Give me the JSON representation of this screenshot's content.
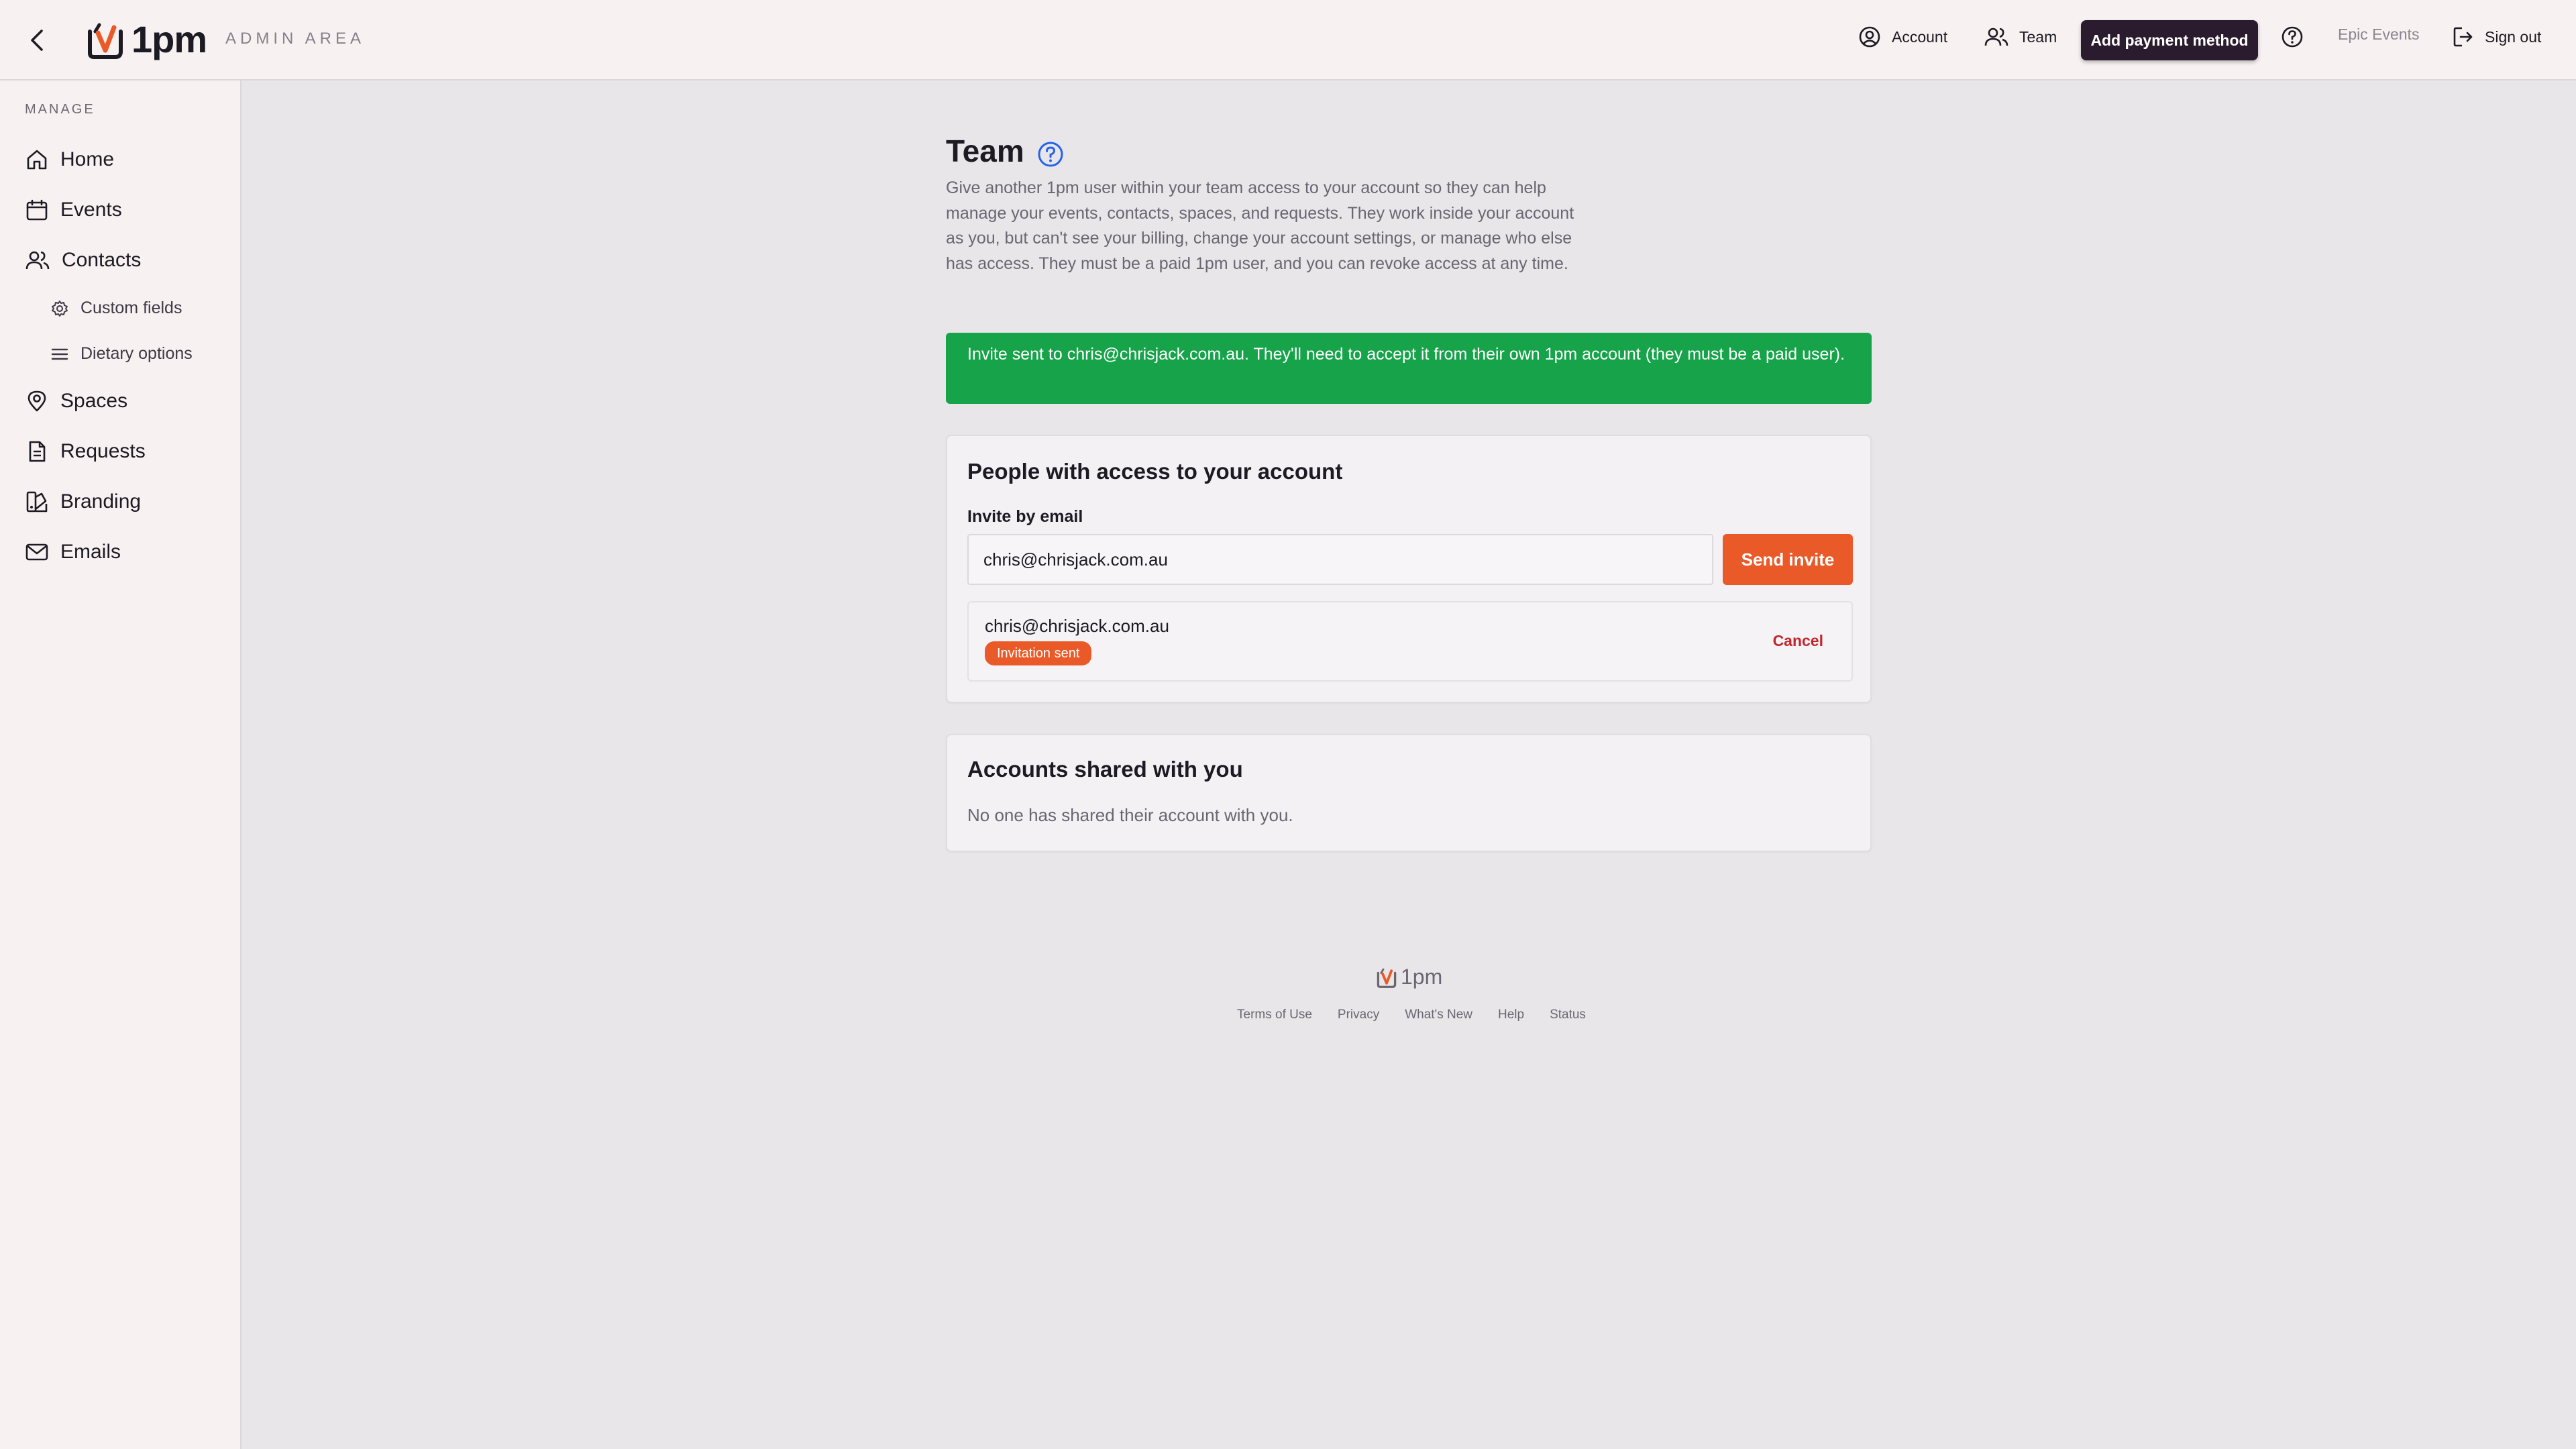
{
  "header": {
    "logo_text": "1pm",
    "area_label": "ADMIN AREA",
    "nav": {
      "account": "Account",
      "team": "Team",
      "add_payment": "Add payment method",
      "org": "Epic Events",
      "sign_out": "Sign out"
    }
  },
  "sidebar": {
    "section_label": "MANAGE",
    "items": [
      {
        "label": "Home",
        "icon": "home-icon"
      },
      {
        "label": "Events",
        "icon": "calendar-icon"
      },
      {
        "label": "Contacts",
        "icon": "users-icon"
      },
      {
        "label": "Custom fields",
        "icon": "gear-icon"
      },
      {
        "label": "Dietary options",
        "icon": "list-icon"
      },
      {
        "label": "Spaces",
        "icon": "map-pin-icon"
      },
      {
        "label": "Requests",
        "icon": "document-icon"
      },
      {
        "label": "Branding",
        "icon": "palette-icon"
      },
      {
        "label": "Emails",
        "icon": "mail-icon"
      }
    ]
  },
  "main": {
    "title": "Team",
    "intro": "Give another 1pm user within your team access to your account so they can help manage your events, contacts, spaces, and requests. They work inside your account as you, but can't see your billing, change your account settings, or manage who else has access. They must be a paid 1pm user, and you can revoke access at any time.",
    "alert": "Invite sent to chris@chrisjack.com.au. They'll need to accept it from their own 1pm account (they must be a paid user).",
    "people_card": {
      "title": "People with access to your account",
      "invite_label": "Invite by email",
      "invite_value": "chris@chrisjack.com.au",
      "send_label": "Send invite",
      "invites": [
        {
          "email": "chris@chrisjack.com.au",
          "status": "Invitation sent",
          "action": "Cancel"
        }
      ]
    },
    "shared_card": {
      "title": "Accounts shared with you",
      "empty_text": "No one has shared their account with you."
    }
  },
  "footer": {
    "logo_text": "1pm",
    "links": [
      "Terms of Use",
      "Privacy",
      "What's New",
      "Help",
      "Status"
    ]
  },
  "colors": {
    "accent_orange": "#ea5a28",
    "success_green": "#17a34a",
    "dark_button": "#2b1b2e",
    "danger_red": "#c0272d"
  }
}
